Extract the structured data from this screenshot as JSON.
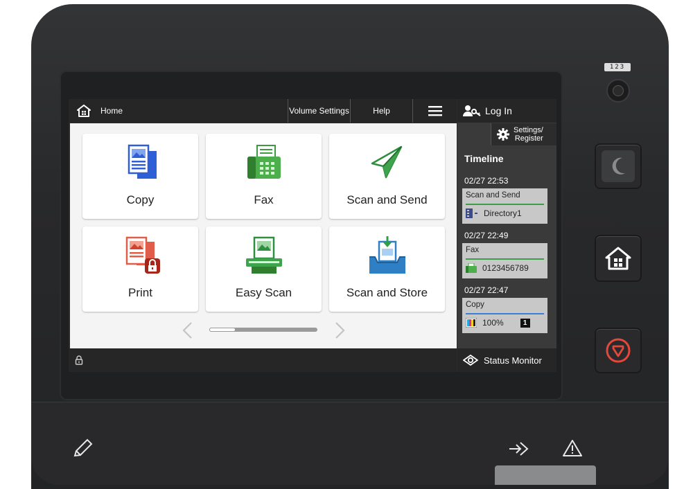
{
  "topbar": {
    "home_label": "Home",
    "volume_label": "Volume Settings",
    "help_label": "Help"
  },
  "tiles": [
    {
      "label": "Copy",
      "icon": "copy-icon"
    },
    {
      "label": "Fax",
      "icon": "fax-icon"
    },
    {
      "label": "Scan and Send",
      "icon": "scan-send-icon"
    },
    {
      "label": "Print",
      "icon": "print-icon"
    },
    {
      "label": "Easy Scan",
      "icon": "easy-scan-icon"
    },
    {
      "label": "Scan and Store",
      "icon": "scan-store-icon"
    }
  ],
  "pager": {
    "current_page": 1,
    "total_pages": 4
  },
  "side": {
    "login_label": "Log In",
    "settings_line1": "Settings/",
    "settings_line2": "Register",
    "timeline_title": "Timeline",
    "status_monitor_label": "Status Monitor",
    "timeline": [
      {
        "time": "02/27 22:53",
        "job": "Scan and Send",
        "detail": "Directory1",
        "accent": "#3f9d4a"
      },
      {
        "time": "02/27 22:49",
        "job": "Fax",
        "detail": "0123456789",
        "accent": "#3f9d4a"
      },
      {
        "time": "02/27 22:47",
        "job": "Copy",
        "detail": "100%",
        "copies": "1",
        "accent": "#3a7fd1"
      }
    ]
  },
  "hardware": {
    "numeric_badge": "123",
    "buttons": [
      "sleep-button",
      "home-button",
      "stop-button"
    ],
    "stop_color": "#e5483b"
  },
  "colors": {
    "topbar_bg": "#262626",
    "sidebar_bg": "#3a3a3a",
    "card_bg": "#c8c8c8",
    "content_bg": "#f4f4f4"
  }
}
